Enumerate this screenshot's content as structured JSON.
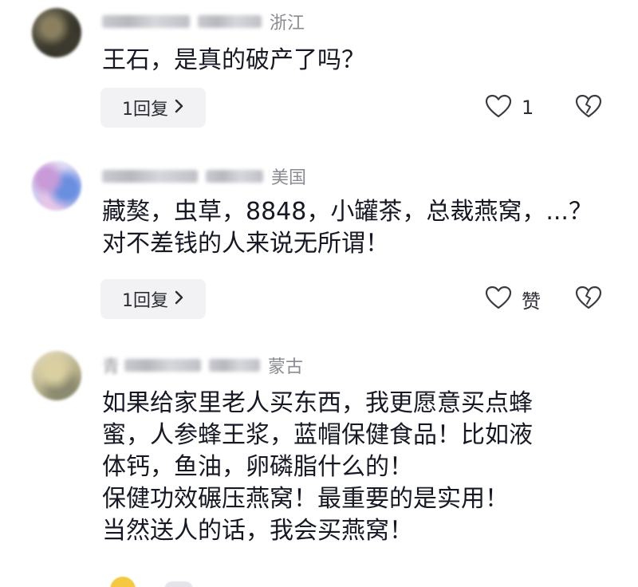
{
  "comments": [
    {
      "location": "浙江",
      "text": "王石，是真的破产了吗？",
      "reply_label": "1回复",
      "like_count": "1"
    },
    {
      "location": "美国",
      "text": "藏獒，虫草，8848，小罐茶，总裁燕窝，...？\n对不差钱的人来说无所谓！",
      "reply_label": "1回复",
      "like_label": "赞"
    },
    {
      "name_fragment": "青",
      "location_fragment": "蒙古",
      "text": "如果给家里老人买东西，我更愿意买点蜂\n蜜，人参蜂王浆，蓝帽保健食品！比如液\n体钙，鱼油，卵磷脂什么的！\n保健功效碾压燕窝！最重要的是实用！\n当然送人的话，我会买燕窝！"
    }
  ],
  "icons": {
    "reply_chevron": "chevron-right-icon",
    "like": "heart-outline-icon",
    "dislike": "broken-heart-icon"
  },
  "colors": {
    "text_primary": "#161823",
    "text_meta": "#8a8b91",
    "reply_bg": "#f2f2f4"
  }
}
